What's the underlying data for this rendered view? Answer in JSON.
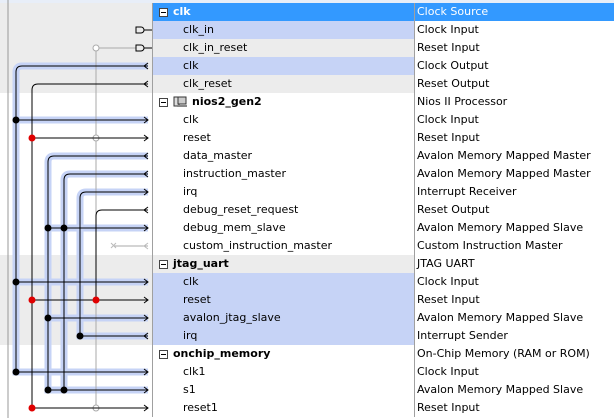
{
  "rows": [
    {
      "name": "clk",
      "desc": "Clock Source"
    },
    {
      "name": "clk_in",
      "desc": "Clock Input"
    },
    {
      "name": "clk_in_reset",
      "desc": "Reset Input"
    },
    {
      "name": "clk",
      "desc": "Clock Output"
    },
    {
      "name": "clk_reset",
      "desc": "Reset Output"
    },
    {
      "name": "nios2_gen2",
      "desc": "Nios II Processor"
    },
    {
      "name": "clk",
      "desc": "Clock Input"
    },
    {
      "name": "reset",
      "desc": "Reset Input"
    },
    {
      "name": "data_master",
      "desc": "Avalon Memory Mapped Master"
    },
    {
      "name": "instruction_master",
      "desc": "Avalon Memory Mapped Master"
    },
    {
      "name": "irq",
      "desc": "Interrupt Receiver"
    },
    {
      "name": "debug_reset_request",
      "desc": "Reset Output"
    },
    {
      "name": "debug_mem_slave",
      "desc": "Avalon Memory Mapped Slave"
    },
    {
      "name": "custom_instruction_master",
      "desc": "Custom Instruction Master"
    },
    {
      "name": "jtag_uart",
      "desc": "JTAG UART"
    },
    {
      "name": "clk",
      "desc": "Clock Input"
    },
    {
      "name": "reset",
      "desc": "Reset Input"
    },
    {
      "name": "avalon_jtag_slave",
      "desc": "Avalon Memory Mapped Slave"
    },
    {
      "name": "irq",
      "desc": "Interrupt Sender"
    },
    {
      "name": "onchip_memory",
      "desc": "On-Chip Memory (RAM or ROM)"
    },
    {
      "name": "clk1",
      "desc": "Clock Input"
    },
    {
      "name": "s1",
      "desc": "Avalon Memory Mapped Slave"
    },
    {
      "name": "reset1",
      "desc": "Reset Input"
    }
  ],
  "colors": {
    "selection": "#3399ff",
    "port_highlight": "#c6d3f6",
    "reset_dot": "#e00000"
  }
}
